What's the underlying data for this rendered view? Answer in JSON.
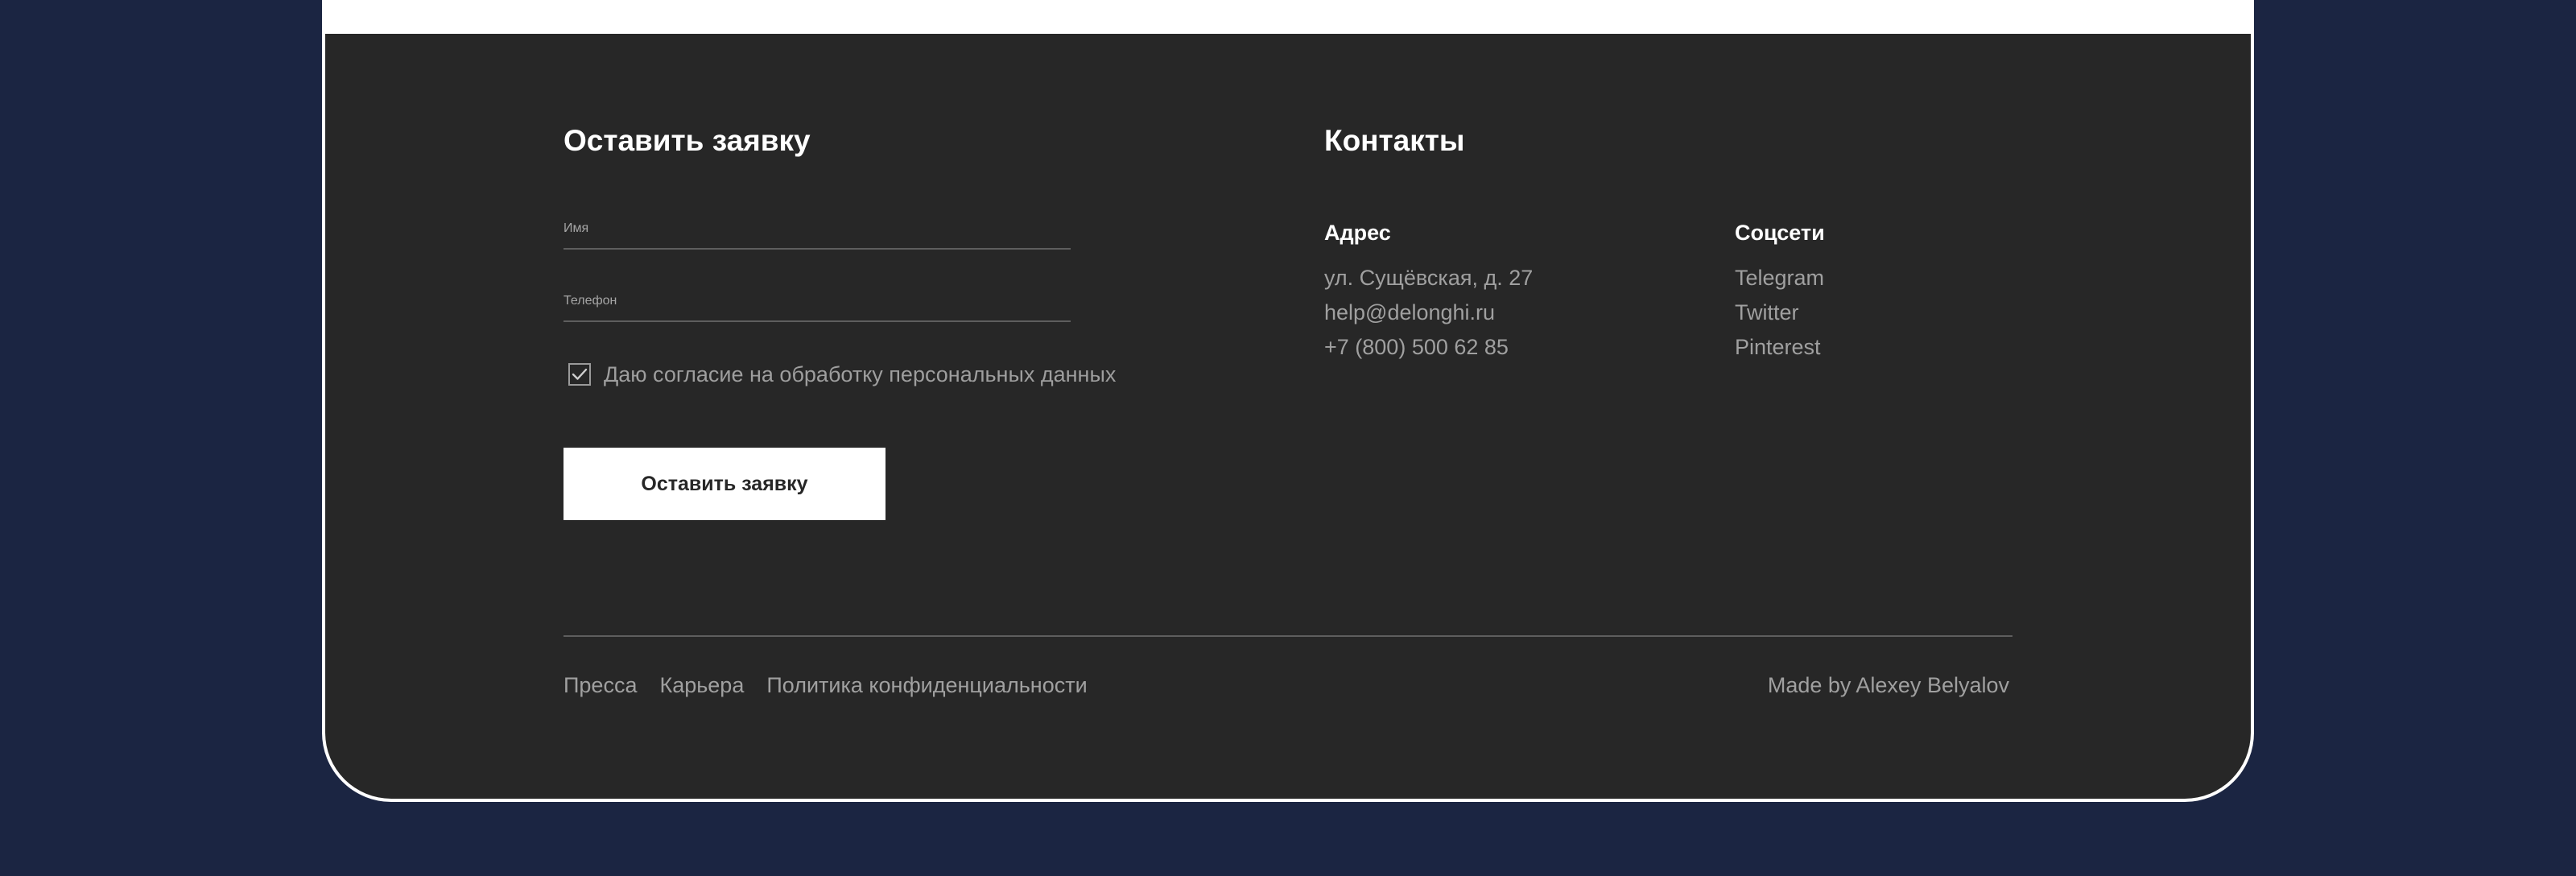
{
  "form": {
    "title": "Оставить заявку",
    "name_label": "Имя",
    "phone_label": "Телефон",
    "consent_text": "Даю согласие на обработку персональных данных",
    "consent_checked": true,
    "submit_label": "Оставить заявку"
  },
  "contacts": {
    "title": "Контакты",
    "address": {
      "heading": "Адрес",
      "items": [
        "ул. Сущёвская, д. 27",
        "help@delonghi.ru",
        "+7 (800) 500 62 85"
      ]
    },
    "social": {
      "heading": "Соцсети",
      "items": [
        "Telegram",
        "Twitter",
        "Pinterest"
      ]
    }
  },
  "bottom": {
    "links": [
      "Пресса",
      "Карьера",
      "Политика конфиденциальности"
    ],
    "credit": "Made by Alexey Belyalov"
  },
  "colors": {
    "page_background": "#1b2542",
    "footer_background": "#272727",
    "button_background": "#ffffff",
    "muted_text": "#a0a0a0"
  },
  "icons": {
    "checkbox": "checkmark-icon"
  }
}
